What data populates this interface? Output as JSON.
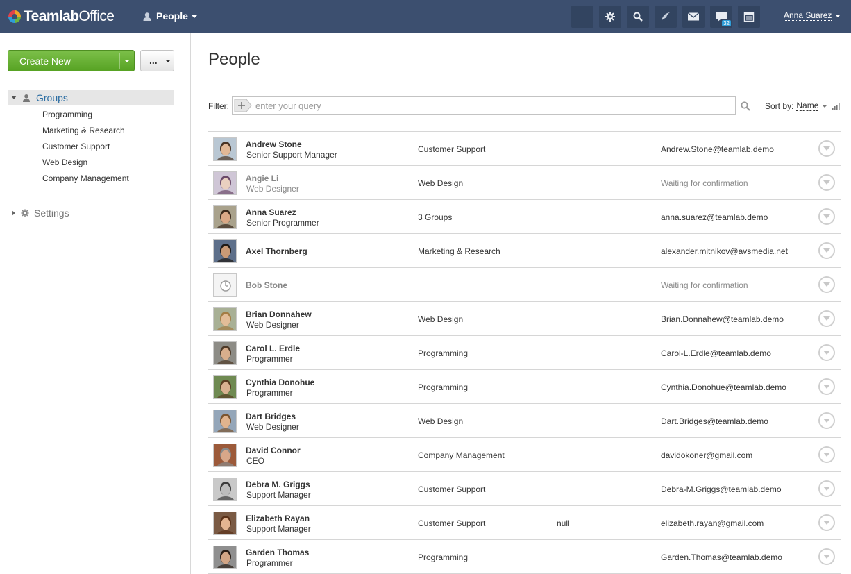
{
  "header": {
    "logo_text_bold": "Teamlab",
    "logo_text_light": "Office",
    "module_label": "People",
    "tools": [
      {
        "icon": "blank-icon"
      },
      {
        "icon": "settings-icon"
      },
      {
        "icon": "search-icon"
      },
      {
        "icon": "feed-icon"
      },
      {
        "icon": "mail-icon"
      },
      {
        "icon": "talk-icon",
        "badge": "32"
      },
      {
        "icon": "calendar-icon"
      }
    ],
    "user_name": "Anna Suarez"
  },
  "sidebar": {
    "create_label": "Create New",
    "more_label": "...",
    "groups_label": "Groups",
    "groups": [
      "Programming",
      "Marketing & Research",
      "Customer Support",
      "Web Design",
      "Company Management"
    ],
    "settings_label": "Settings"
  },
  "main": {
    "title": "People",
    "filter_label": "Filter:",
    "filter_placeholder": "enter your query",
    "sort_label": "Sort by:",
    "sort_value": "Name"
  },
  "people": [
    {
      "name": "Andrew Stone",
      "title": "Senior Support Manager",
      "dept": "Customer Support",
      "extra": "",
      "email": "Andrew.Stone@teamlab.demo",
      "pending": false,
      "avatar": {
        "bg": "#b9c7d3",
        "skin": "#e2b896",
        "hair": "#4a3424"
      }
    },
    {
      "name": "Angie Li",
      "title": "Web Designer",
      "dept": "Web Design",
      "extra": "",
      "email": "Waiting for confirmation",
      "pending": true,
      "avatar": {
        "bg": "#cfc6d6",
        "skin": "#e9d0c0",
        "hair": "#6b4a6a"
      }
    },
    {
      "name": "Anna Suarez",
      "title": "Senior Programmer",
      "dept": "3 Groups",
      "extra": "",
      "email": "anna.suarez@teamlab.demo",
      "pending": false,
      "avatar": {
        "bg": "#a9a28c",
        "skin": "#d9a886",
        "hair": "#3b2a1c"
      }
    },
    {
      "name": "Axel Thornberg",
      "title": "",
      "dept": "Marketing & Research",
      "extra": "",
      "email": "alexander.mitnikov@avsmedia.net",
      "pending": false,
      "avatar": {
        "bg": "#5d6f8a",
        "skin": "#c99a76",
        "hair": "#1f1a16"
      }
    },
    {
      "name": "Bob Stone",
      "title": "",
      "dept": "",
      "extra": "",
      "email": "Waiting for confirmation",
      "pending": true,
      "avatar": {
        "bg": "#f0f0f0",
        "skin": "#f0f0f0",
        "hair": "#f0f0f0"
      }
    },
    {
      "name": "Brian Donnahew",
      "title": "Web Designer",
      "dept": "Web Design",
      "extra": "",
      "email": "Brian.Donnahew@teamlab.demo",
      "pending": false,
      "avatar": {
        "bg": "#a8b095",
        "skin": "#e3bd98",
        "hair": "#a47d45"
      }
    },
    {
      "name": "Carol L. Erdle",
      "title": "Programmer",
      "dept": "Programming",
      "extra": "",
      "email": "Carol-L.Erdle@teamlab.demo",
      "pending": false,
      "avatar": {
        "bg": "#8d8c86",
        "skin": "#d8ae8c",
        "hair": "#4e3a28"
      }
    },
    {
      "name": "Cynthia Donohue",
      "title": "Programmer",
      "dept": "Programming",
      "extra": "",
      "email": "Cynthia.Donohue@teamlab.demo",
      "pending": false,
      "avatar": {
        "bg": "#6f8a52",
        "skin": "#d9b190",
        "hair": "#5a3e22"
      }
    },
    {
      "name": "Dart Bridges",
      "title": "Web Designer",
      "dept": "Web Design",
      "extra": "",
      "email": "Dart.Bridges@teamlab.demo",
      "pending": false,
      "avatar": {
        "bg": "#94a6b9",
        "skin": "#e0b48e",
        "hair": "#7a5530"
      }
    },
    {
      "name": "David Connor",
      "title": "CEO",
      "dept": "Company Management",
      "extra": "",
      "email": "davidokoner@gmail.com",
      "pending": false,
      "avatar": {
        "bg": "#9c5a3a",
        "skin": "#d8a789",
        "hair": "#8a8a8a"
      }
    },
    {
      "name": "Debra M. Griggs",
      "title": "Support Manager",
      "dept": "Customer Support",
      "extra": "",
      "email": "Debra-M.Griggs@teamlab.demo",
      "pending": false,
      "avatar": {
        "bg": "#c9c9c9",
        "skin": "#bdbdbd",
        "hair": "#3c3c3c"
      }
    },
    {
      "name": "Elizabeth Rayan",
      "title": "Support Manager",
      "dept": "Customer Support",
      "extra": "null",
      "email": "elizabeth.rayan@gmail.com",
      "pending": false,
      "avatar": {
        "bg": "#7a5a44",
        "skin": "#e3b592",
        "hair": "#5b3219"
      }
    },
    {
      "name": "Garden Thomas",
      "title": "Programmer",
      "dept": "Programming",
      "extra": "",
      "email": "Garden.Thomas@teamlab.demo",
      "pending": false,
      "avatar": {
        "bg": "#8f8f8f",
        "skin": "#d2a585",
        "hair": "#2a1e16"
      }
    }
  ]
}
